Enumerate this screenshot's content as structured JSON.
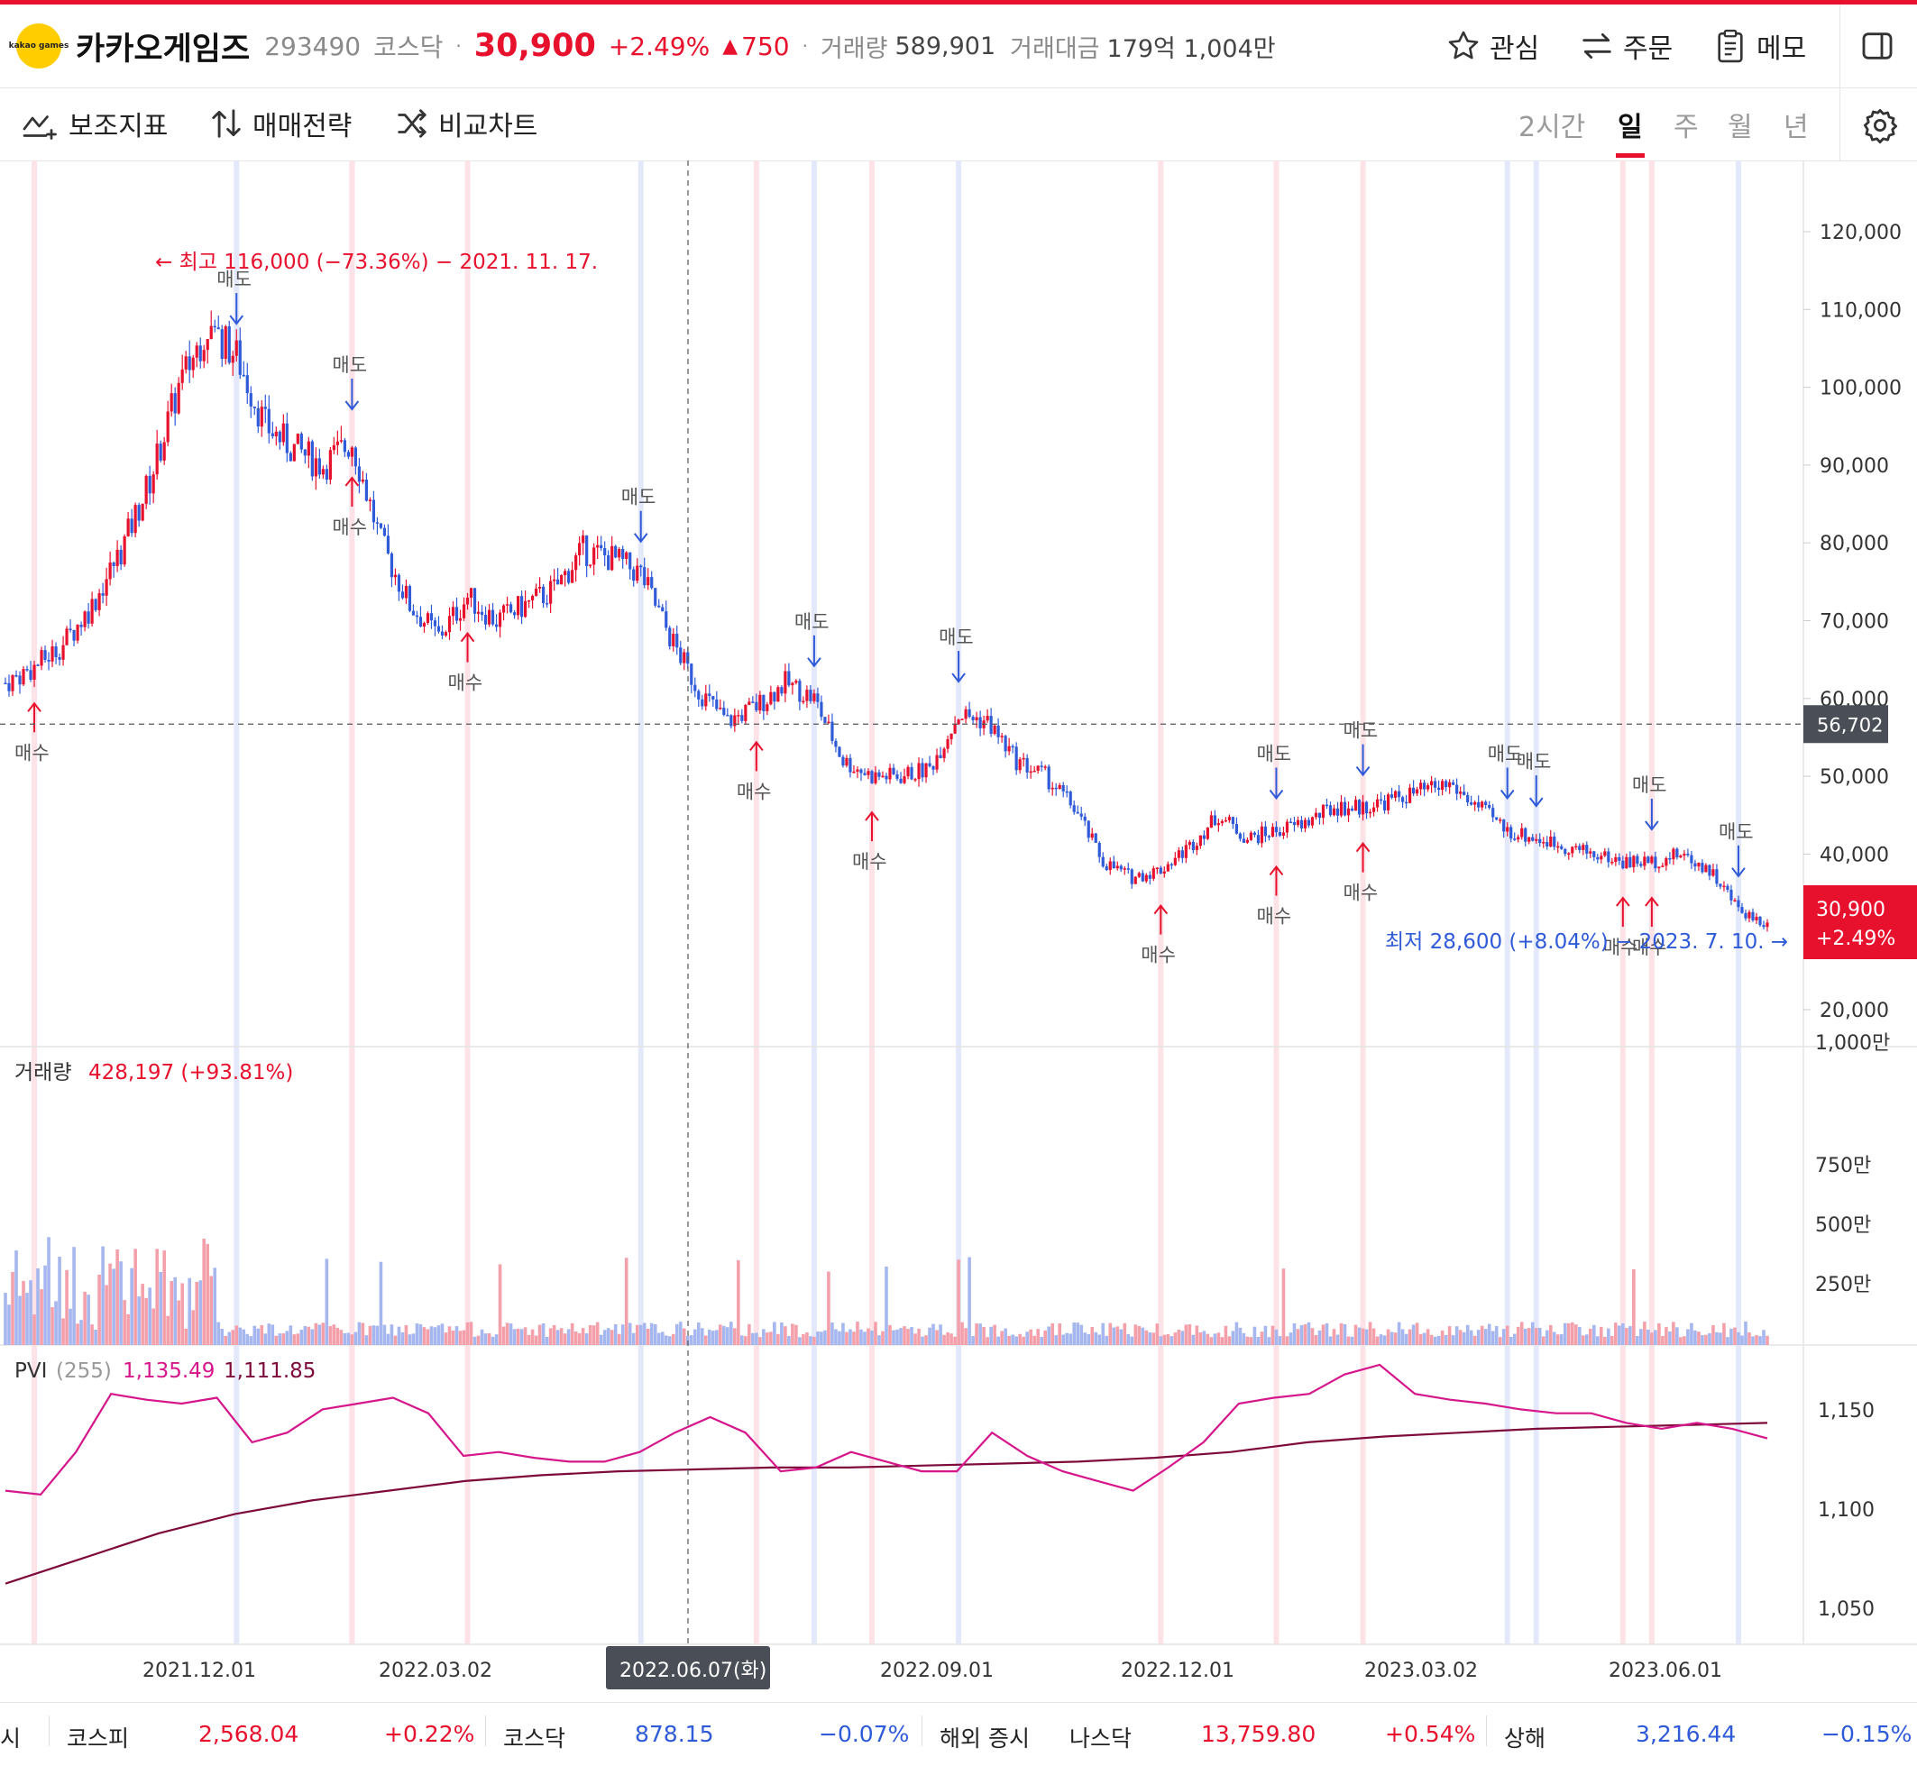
{
  "stock": {
    "logo_text": "kakao games",
    "name": "카카오게임즈",
    "code": "293490",
    "market": "코스닥",
    "price": "30,900",
    "change_pct": "+2.49%",
    "change_abs": "750",
    "volume_label": "거래량",
    "volume_value": "589,901",
    "amount_label": "거래대금",
    "amount_value": "179억 1,004만"
  },
  "header_actions": {
    "watch": "관심",
    "order": "주문",
    "memo": "메모"
  },
  "toolbar": {
    "indicators": "보조지표",
    "strategy": "매매전략",
    "compare": "비교차트",
    "periods": [
      "2시간",
      "일",
      "주",
      "월",
      "년"
    ],
    "active_period": "일"
  },
  "colors": {
    "up": "#e8112d",
    "down": "#2f5ad8",
    "pvi": "#d6168b",
    "pvi_signal": "#7d0a3a"
  },
  "chart_data": {
    "type": "candlestick",
    "price_axis": {
      "min": 20000,
      "max": 120000,
      "ticks": [
        "120,000",
        "110,000",
        "100,000",
        "90,000",
        "80,000",
        "70,000",
        "60,000",
        "50,000",
        "40,000",
        "30,000",
        "20,000"
      ]
    },
    "x_ticks": [
      "2021.12.01",
      "2022.03.02",
      "2022.09.01",
      "2022.12.01",
      "2023.03.02",
      "2023.06.01"
    ],
    "crosshair": {
      "date": "2022.06.07(화)",
      "price": "56,702"
    },
    "current": {
      "price": "30,900",
      "change": "+2.49%"
    },
    "high_label": "← 최고 116,000 (−73.36%) − 2021. 11. 17.",
    "low_label": "최저 28,600 (+8.04%) − 2023. 7. 10. →",
    "close_series": [
      62000,
      64000,
      67000,
      72000,
      79000,
      88000,
      100000,
      108000,
      104000,
      95000,
      92000,
      90000,
      93000,
      80000,
      72000,
      68000,
      73000,
      70000,
      72000,
      74000,
      79000,
      78000,
      76000,
      68000,
      61000,
      57000,
      59000,
      62000,
      60000,
      52000,
      50000,
      50000,
      51000,
      58000,
      57000,
      52000,
      50000,
      46000,
      39000,
      37000,
      38000,
      41000,
      45000,
      42000,
      43000,
      44000,
      46000,
      46000,
      47000,
      48000,
      49000,
      46000,
      43000,
      42000,
      41000,
      40000,
      39000,
      39000,
      40000,
      38000,
      33000,
      30900
    ],
    "signals": [
      {
        "type": "buy",
        "label": "매수",
        "date_index": 1
      },
      {
        "type": "sell",
        "label": "매도",
        "date_index": 8
      },
      {
        "type": "sell",
        "label": "매도",
        "date_index": 12
      },
      {
        "type": "buy",
        "label": "매수",
        "date_index": 12
      },
      {
        "type": "buy",
        "label": "매수",
        "date_index": 16
      },
      {
        "type": "sell",
        "label": "매도",
        "date_index": 22
      },
      {
        "type": "buy",
        "label": "매수",
        "date_index": 26
      },
      {
        "type": "sell",
        "label": "매도",
        "date_index": 28
      },
      {
        "type": "buy",
        "label": "매수",
        "date_index": 30
      },
      {
        "type": "sell",
        "label": "매도",
        "date_index": 33
      },
      {
        "type": "buy",
        "label": "매수",
        "date_index": 40
      },
      {
        "type": "sell",
        "label": "매도",
        "date_index": 44
      },
      {
        "type": "buy",
        "label": "매수",
        "date_index": 44
      },
      {
        "type": "sell",
        "label": "매도",
        "date_index": 47
      },
      {
        "type": "buy",
        "label": "매수",
        "date_index": 47
      },
      {
        "type": "sell",
        "label": "매도",
        "date_index": 52
      },
      {
        "type": "sell",
        "label": "매도",
        "date_index": 53
      },
      {
        "type": "buy",
        "label": "매수",
        "date_index": 56
      },
      {
        "type": "sell",
        "label": "매도",
        "date_index": 57
      },
      {
        "type": "buy",
        "label": "매수",
        "date_index": 57
      },
      {
        "type": "sell",
        "label": "매도",
        "date_index": 60
      }
    ],
    "volume": {
      "label": "거래량",
      "value": "428,197 (+93.81%)",
      "ticks": [
        "1,000만",
        "750만",
        "500만",
        "250만"
      ],
      "max": 11000000
    },
    "pvi": {
      "label": "PVI",
      "period": "(255)",
      "value1": "1,135.49",
      "value2": "1,111.85",
      "ticks": [
        "1,150",
        "1,100",
        "1,050"
      ],
      "range": [
        1030,
        1165
      ],
      "line": [
        1100,
        1098,
        1120,
        1150,
        1147,
        1145,
        1148,
        1125,
        1130,
        1142,
        1145,
        1148,
        1140,
        1118,
        1120,
        1117,
        1115,
        1115,
        1120,
        1130,
        1138,
        1130,
        1110,
        1112,
        1120,
        1115,
        1110,
        1110,
        1130,
        1118,
        1110,
        1105,
        1100,
        1112,
        1125,
        1145,
        1148,
        1150,
        1160,
        1165,
        1150,
        1147,
        1145,
        1142,
        1140,
        1140,
        1135,
        1132,
        1135,
        1132,
        1127
      ],
      "signal": [
        1052,
        1065,
        1078,
        1088,
        1095,
        1100,
        1105,
        1108,
        1110,
        1111,
        1112,
        1112,
        1113,
        1114,
        1115,
        1117,
        1120,
        1125,
        1128,
        1130,
        1132,
        1133,
        1134,
        1135
      ]
    }
  },
  "footer": {
    "trail": "시",
    "kospi_label": "코스피",
    "kospi_value": "2,568.04",
    "kospi_change": "+0.22%",
    "kosdaq_label": "코스닥",
    "kosdaq_value": "878.15",
    "kosdaq_change": "−0.07%",
    "overseas": "해외 증시",
    "nasdaq_label": "나스닥",
    "nasdaq_value": "13,759.80",
    "nasdaq_change": "+0.54%",
    "shanghai_label": "상해",
    "shanghai_value": "3,216.44",
    "shanghai_change": "−0.15%"
  }
}
